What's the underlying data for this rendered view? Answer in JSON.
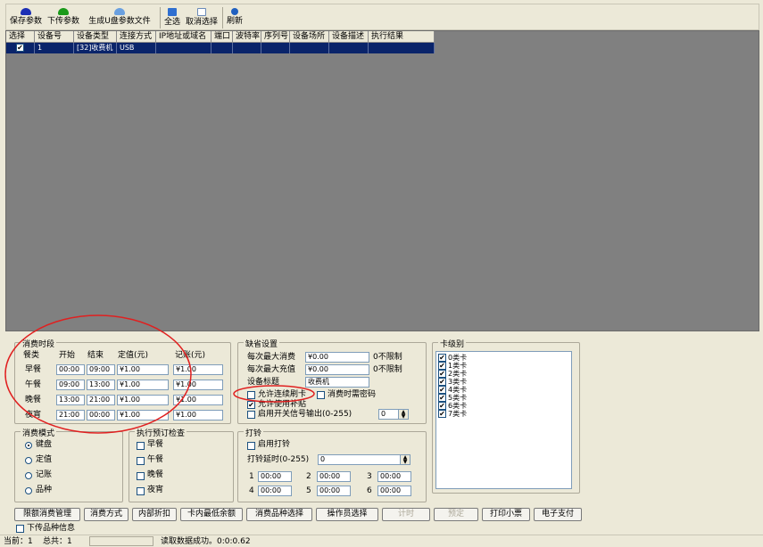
{
  "toolbar": {
    "buttons": [
      {
        "label": "保存参数",
        "icon": "save-icon",
        "color": "#1c2fb5"
      },
      {
        "label": "下传参数",
        "icon": "download-icon",
        "color": "#1a9a1a"
      },
      {
        "label": "生成U盘参数文件",
        "icon": "usb-file-icon",
        "color": "#6aa0e0"
      },
      {
        "label": "全选",
        "icon": "select-all-icon",
        "color": "#2f6fd0"
      },
      {
        "label": "取消选择",
        "icon": "deselect-icon",
        "color": "#9ab8e0"
      },
      {
        "label": "刷新",
        "icon": "refresh-icon",
        "color": "#2060c0"
      }
    ]
  },
  "grid": {
    "headers": [
      "选择",
      "设备号",
      "设备类型",
      "连接方式",
      "IP地址或域名",
      "端口",
      "波特率",
      "序列号",
      "设备场所",
      "设备描述",
      "执行结果"
    ],
    "rows": [
      {
        "checked": "✔",
        "cells": [
          "1",
          "[32]收费机",
          "USB",
          "",
          "",
          "",
          "",
          "",
          "",
          ""
        ]
      }
    ]
  },
  "meal": {
    "title": "消费时段",
    "headers": [
      "餐类",
      "开始",
      "结束",
      "定值(元)",
      "记账(元)"
    ],
    "rows": [
      {
        "name": "早餐",
        "start": "00:00",
        "end": "09:00",
        "fixed": "¥1.00",
        "account": "¥1.00"
      },
      {
        "name": "午餐",
        "start": "09:00",
        "end": "13:00",
        "fixed": "¥1.00",
        "account": "¥1.00"
      },
      {
        "name": "晚餐",
        "start": "13:00",
        "end": "21:00",
        "fixed": "¥1.00",
        "account": "¥1.00"
      },
      {
        "name": "夜宵",
        "start": "21:00",
        "end": "00:00",
        "fixed": "¥1.00",
        "account": "¥1.00"
      }
    ]
  },
  "defaults": {
    "title": "缺省设置",
    "max_consume_label": "每次最大消费",
    "max_consume": "¥0.00",
    "max_consume_hint": "0不限制",
    "max_recharge_label": "每次最大充值",
    "max_recharge": "¥0.00",
    "max_recharge_hint": "0不限制",
    "device_title_label": "设备标题",
    "device_title": "收费机",
    "allow_continuous": "允许连续刷卡",
    "need_password": "消费时需密码",
    "allow_subsidy": "允许使用补贴",
    "enable_switch": "启用开关信号输出(0-255)",
    "switch_value": "0"
  },
  "card_level": {
    "title": "卡级别",
    "items": [
      "0类卡",
      "1类卡",
      "2类卡",
      "3类卡",
      "4类卡",
      "5类卡",
      "6类卡",
      "7类卡"
    ]
  },
  "mode": {
    "title": "消费模式",
    "options": [
      "键盘",
      "定值",
      "记账",
      "品种"
    ],
    "selected": "键盘"
  },
  "preorder": {
    "title": "执行预订检查",
    "items": [
      "早餐",
      "午餐",
      "晚餐",
      "夜宵"
    ]
  },
  "bell": {
    "title": "打铃",
    "enable": "启用打铃",
    "delay_label": "打铃延时(0-255)",
    "delay": "0",
    "slots": [
      {
        "n": "1",
        "t": "00:00"
      },
      {
        "n": "2",
        "t": "00:00"
      },
      {
        "n": "3",
        "t": "00:00"
      },
      {
        "n": "4",
        "t": "00:00"
      },
      {
        "n": "5",
        "t": "00:00"
      },
      {
        "n": "6",
        "t": "00:00"
      }
    ]
  },
  "buttons": [
    "限额消费管理",
    "消费方式",
    "内部折扣",
    "卡内最低余额",
    "消费品种选择",
    "操作员选择",
    "计时",
    "预定",
    "打印小票",
    "电子支付"
  ],
  "download_items": "下传品种信息",
  "status": {
    "current": "当前：1",
    "total": "总共：1",
    "message": "读取数据成功。0:0:0.62"
  },
  "annotation_color": "#e02020"
}
